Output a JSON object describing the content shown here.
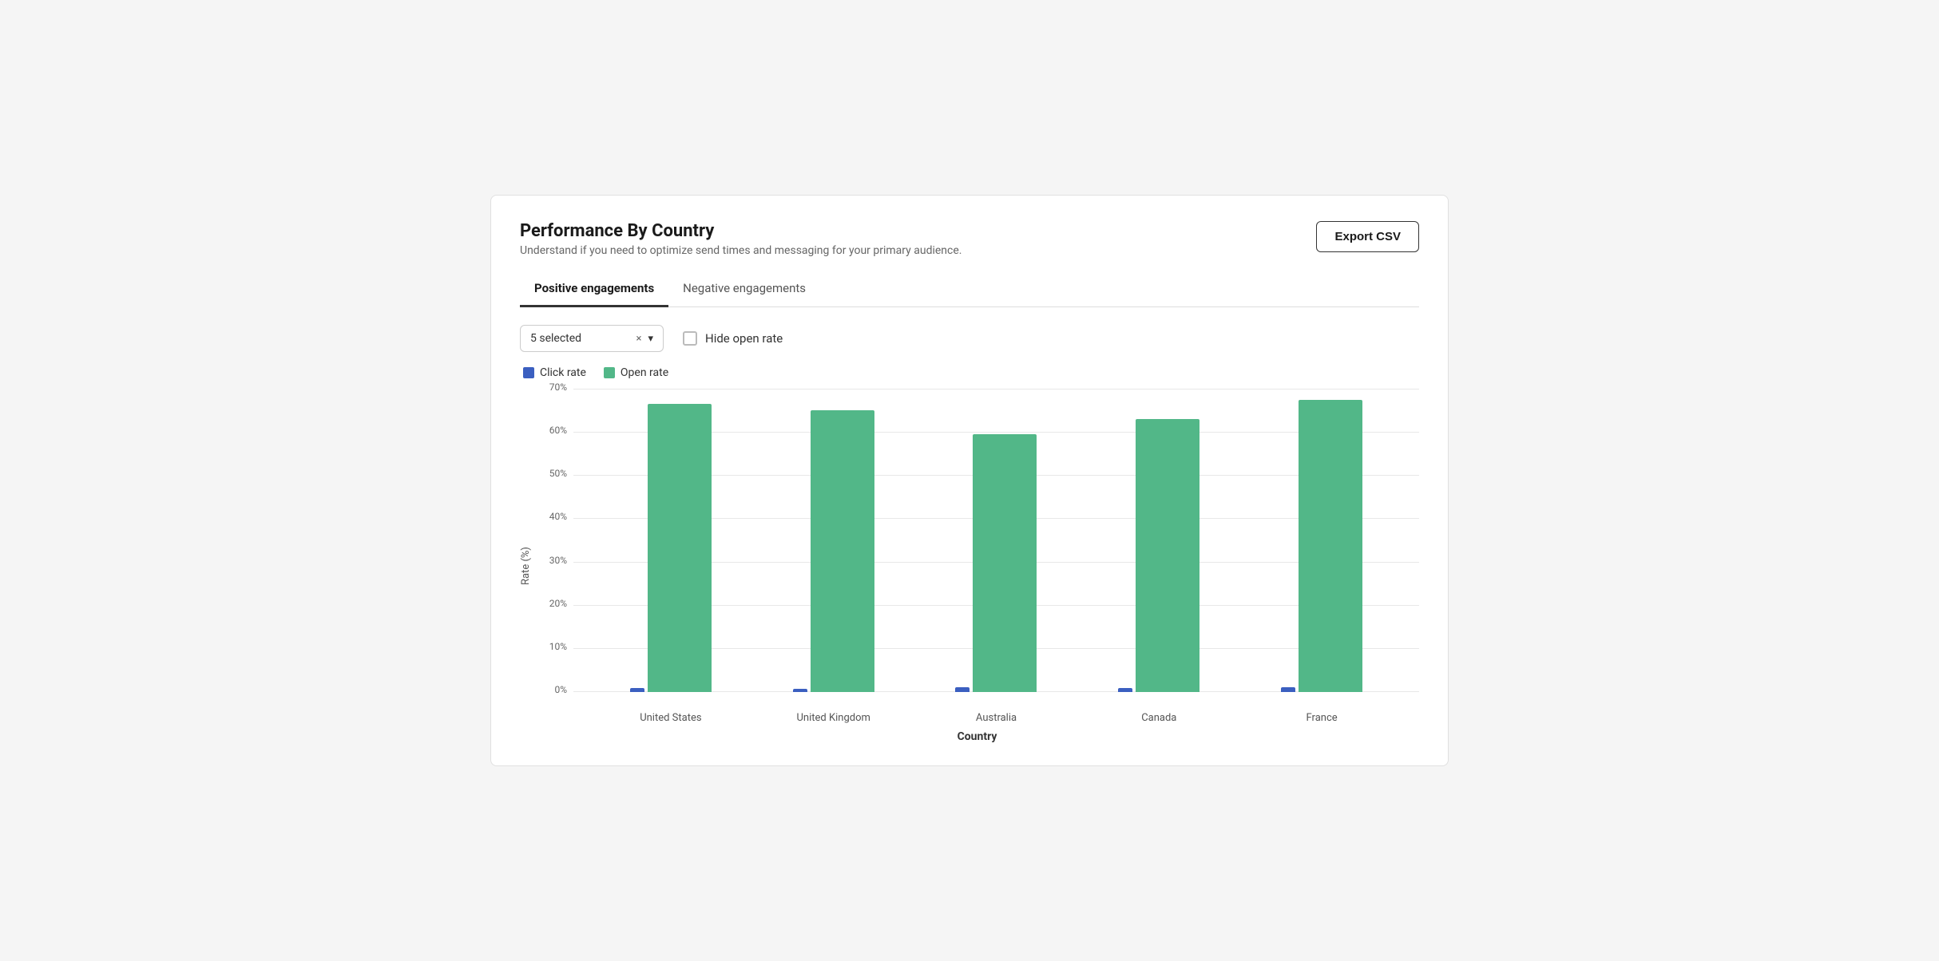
{
  "header": {
    "title": "Performance By Country",
    "subtitle": "Understand if you need to optimize send times and messaging for your primary audience.",
    "export_button_label": "Export CSV"
  },
  "tabs": [
    {
      "id": "positive",
      "label": "Positive engagements",
      "active": true
    },
    {
      "id": "negative",
      "label": "Negative engagements",
      "active": false
    }
  ],
  "controls": {
    "dropdown_selected": "5 selected",
    "dropdown_clear": "×",
    "hide_open_rate_label": "Hide open rate",
    "checked": false
  },
  "legend": [
    {
      "id": "click-rate",
      "label": "Click rate",
      "color": "#3b5fc0"
    },
    {
      "id": "open-rate",
      "label": "Open rate",
      "color": "#52b788"
    }
  ],
  "chart": {
    "y_axis_label": "Rate (%)",
    "x_axis_label": "Country",
    "y_ticks": [
      "70%",
      "60%",
      "50%",
      "40%",
      "30%",
      "20%",
      "10%",
      "0%"
    ],
    "countries": [
      {
        "name": "United States",
        "click_rate": 1.0,
        "open_rate": 66.5
      },
      {
        "name": "United Kingdom",
        "click_rate": 0.8,
        "open_rate": 65.0
      },
      {
        "name": "Australia",
        "click_rate": 1.2,
        "open_rate": 59.5
      },
      {
        "name": "Canada",
        "click_rate": 0.9,
        "open_rate": 63.0
      },
      {
        "name": "France",
        "click_rate": 1.1,
        "open_rate": 67.5
      }
    ],
    "max_value": 70
  }
}
